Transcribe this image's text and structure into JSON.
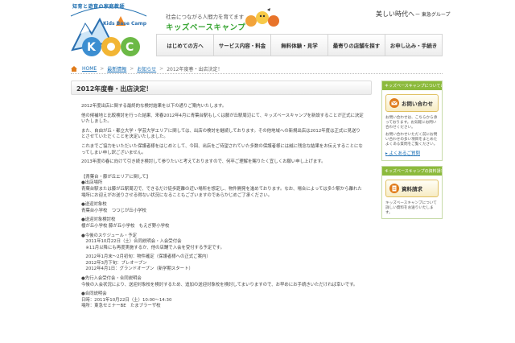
{
  "header": {
    "logo_arc_text": "知育と遊育の家庭教師",
    "logo_sub": "Kids Base Camp",
    "tagline": "社会につながる人間力を育てます",
    "brand_name": "キッズベースキャンプ",
    "group_slogan": "美しい時代へ",
    "group_name": "ー 東急グループ"
  },
  "nav": {
    "items": [
      "はじめての方へ",
      "サービス内容・料金",
      "無料体験・見学",
      "最寄りの店舗を探す",
      "お申し込み・手続き"
    ]
  },
  "breadcrumb": {
    "home": "HOME",
    "sep": ">",
    "level1": "最新情報",
    "level2": "お知らせ",
    "current": "2012年度春・出店決定！"
  },
  "main": {
    "title": "2012年度春・出店決定！",
    "paragraphs": [
      "2012年度出店に関する最終的な検討結果を以下の通りご案内いたします。",
      "他の候補地と比較検討を行った結果、来春2012年4月に青葉台駅もしくは藤が丘駅周辺にて、キッズベースキャンプを新設することが正式に決定いたしました。",
      "また、自由が丘・都立大学・学芸大学エリアに関しては、出店の検討を継続しております。その他地域への新規出店は2012年度は正式に見送りとさせていただくことを決定いたしました。",
      "これまでご協力をいただいた保護者様をはじめとして、今回、出店をご待望されていた多数の保護者様には誠に残念な結果をお伝えすることになってしまい申し訳ございません。",
      "2013年度の春に向けて引き続き検討して参りたいと考えておりますので、何卒ご理解を賜りたく宜しくお願い申し上げます。",
      "【青葉台・藤が丘エリアに関して】",
      "●出店場所",
      "青葉台駅または藤が丘駅周辺で、できるだけ徒歩距離の近い場所を想定し、物件開発を進めております。なお、場合によっては多少駅から離れた場所にお迎えがお送りさせる得ない状況になることもございますのであらかじめご了承ください。",
      "●送迎対象校",
      "青葉台小学校　つつじが丘小学校",
      "●送迎対象検討校",
      "榎が丘小学校 藤が丘小学校　もえぎ野小学校",
      "●今後のスケジュール・予定",
      "　2011年10月22日（土）合同説明会・入会受付会",
      "　※11月以降にも再度実施するか、他の店舗で入会を受付する予定です。",
      "　2012年1月末〜2月初旬：物件確定（保護者様への正式ご案内）",
      "　2012年3月下旬：プレオープン",
      "　2012年4月1日：グランドオープン（新学期スタート）",
      "●先行入会受付会・合同説明会",
      "今後の入会状況により、送迎対象校を検討するため、追加の送迎対象校を検討してまいりますので、お早めにお手続きいただければ幸いです。",
      "●合同説明会",
      "日時：2011年10月22日（土）10:00〜14:30",
      "場所：東急セミナーBE　たまプラーザ校"
    ]
  },
  "sidebar": {
    "box1_head": "キッズベースキャンプについてのお問い合わせ",
    "box1_button": "お問い合わせ",
    "box1_text1": "お問い合わせは、こちらから承っております。お気軽にお問い合わせください。",
    "box1_text2": "お問い合わせいただく前にお問い合わせの多い項目をまとめたよくある質問をご覧ください。",
    "box1_link": "よくあるご質問",
    "box2_head": "キッズベースキャンプの資料請求",
    "box2_button": "資料請求",
    "box2_text": "キッズベースキャンプについて詳しい資料をお送りいたします。"
  },
  "colors": {
    "accent_green": "#8cba3c",
    "brand_green": "#3aa635",
    "link_blue": "#1a6fb5"
  }
}
